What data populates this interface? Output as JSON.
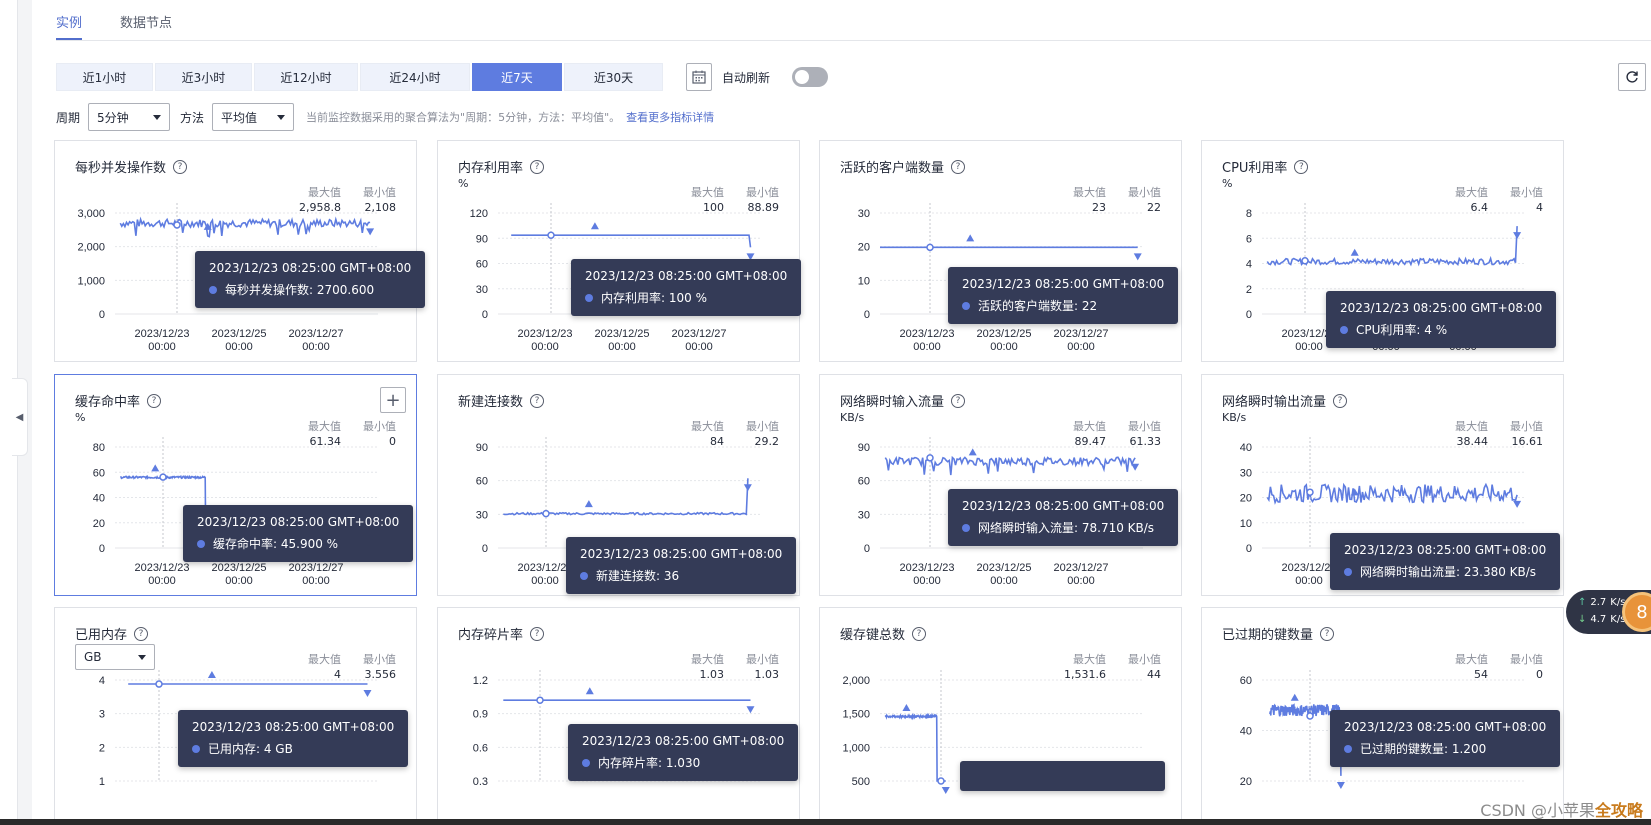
{
  "tabs": [
    {
      "label": "实例",
      "active": true
    },
    {
      "label": "数据节点",
      "active": false
    }
  ],
  "toolbar": {
    "time_ranges": [
      {
        "label": "近1小时",
        "active": false
      },
      {
        "label": "近3小时",
        "active": false
      },
      {
        "label": "近12小时",
        "active": false
      },
      {
        "label": "近24小时",
        "active": false
      },
      {
        "label": "近7天",
        "active": true
      },
      {
        "label": "近30天",
        "active": false
      }
    ],
    "auto_refresh_label": "自动刷新",
    "auto_refresh_on": false
  },
  "filters": {
    "period_label": "周期",
    "period_value": "5分钟",
    "method_label": "方法",
    "method_value": "平均值",
    "note": "当前监控数据采用的聚合算法为\"周期：5分钟，方法：平均值\"。",
    "link": "查看更多指标详情"
  },
  "labels": {
    "max": "最大值",
    "min": "最小值"
  },
  "tooltip_time": "2023/12/23 08:25:00 GMT+08:00",
  "x_ticks": [
    [
      "2023/12/23",
      "00:00"
    ],
    [
      "2023/12/25",
      "00:00"
    ],
    [
      "2023/12/27",
      "00:00"
    ]
  ],
  "charts": [
    {
      "title": "每秒并发操作数",
      "unit": "",
      "max": "2,958.8",
      "min": "2,108",
      "yticks": [
        "0",
        "1,000",
        "2,000",
        "3,000"
      ],
      "ymax": 3000,
      "tooltip_label": "每秒并发操作数: 2700.600",
      "color": "#5e7ce0"
    },
    {
      "title": "内存利用率",
      "unit": "%",
      "max": "100",
      "min": "88.89",
      "yticks": [
        "0",
        "30",
        "60",
        "90",
        "120"
      ],
      "ymax": 120,
      "tooltip_label": "内存利用率: 100 %",
      "color": "#5e7ce0"
    },
    {
      "title": "活跃的客户端数量",
      "unit": "",
      "max": "23",
      "min": "22",
      "yticks": [
        "0",
        "10",
        "20",
        "30"
      ],
      "ymax": 30,
      "tooltip_label": "活跃的客户端数量: 22",
      "color": "#5e7ce0"
    },
    {
      "title": "CPU利用率",
      "unit": "%",
      "max": "6.4",
      "min": "4",
      "yticks": [
        "0",
        "2",
        "4",
        "6",
        "8"
      ],
      "ymax": 8,
      "tooltip_label": "CPU利用率: 4 %",
      "color": "#5e7ce0"
    },
    {
      "title": "缓存命中率",
      "unit": "%",
      "max": "61.34",
      "min": "0",
      "yticks": [
        "0",
        "20",
        "40",
        "60",
        "80"
      ],
      "ymax": 80,
      "tooltip_label": "缓存命中率: 45.900 %",
      "color": "#5e7ce0",
      "selected": true
    },
    {
      "title": "新建连接数",
      "unit": "",
      "max": "84",
      "min": "29.2",
      "yticks": [
        "0",
        "30",
        "60",
        "90"
      ],
      "ymax": 90,
      "tooltip_label": "新建连接数: 36",
      "color": "#5e7ce0"
    },
    {
      "title": "网络瞬时输入流量",
      "unit": "KB/s",
      "max": "89.47",
      "min": "61.33",
      "yticks": [
        "0",
        "30",
        "60",
        "90"
      ],
      "ymax": 90,
      "tooltip_label": "网络瞬时输入流量: 78.710 KB/s",
      "color": "#5e7ce0"
    },
    {
      "title": "网络瞬时输出流量",
      "unit": "KB/s",
      "max": "38.44",
      "min": "16.61",
      "yticks": [
        "0",
        "10",
        "20",
        "30",
        "40"
      ],
      "ymax": 40,
      "tooltip_label": "网络瞬时输出流量: 23.380 KB/s",
      "color": "#5e7ce0"
    },
    {
      "title": "已用内存",
      "unit_select": "GB",
      "max": "4",
      "min": "3.556",
      "yticks": [
        "1",
        "2",
        "3",
        "4"
      ],
      "ymax": 4,
      "tooltip_label": "已用内存: 4 GB",
      "color": "#5e7ce0"
    },
    {
      "title": "内存碎片率",
      "unit": "",
      "max": "1.03",
      "min": "1.03",
      "yticks": [
        "0.3",
        "0.6",
        "0.9",
        "1.2"
      ],
      "ymax": 1.2,
      "tooltip_label": "内存碎片率: 1.030",
      "color": "#5e7ce0"
    },
    {
      "title": "缓存键总数",
      "unit": "",
      "max": "1,531.6",
      "min": "44",
      "yticks": [
        "500",
        "1,000",
        "1,500",
        "2,000"
      ],
      "ymax": 2000,
      "tooltip_label": "",
      "color": "#5e7ce0"
    },
    {
      "title": "已过期的键数量",
      "unit": "",
      "max": "54",
      "min": "0",
      "yticks": [
        "20",
        "40",
        "60"
      ],
      "ymax": 60,
      "tooltip_label": "已过期的键数量: 1.200",
      "color": "#5e7ce0"
    }
  ],
  "net_widget": {
    "up": "2.7",
    "down": "4.7",
    "unit": "K/s",
    "ball": "8"
  },
  "watermark": {
    "text": "CSDN @小苹果",
    "brand": "全攻略"
  }
}
